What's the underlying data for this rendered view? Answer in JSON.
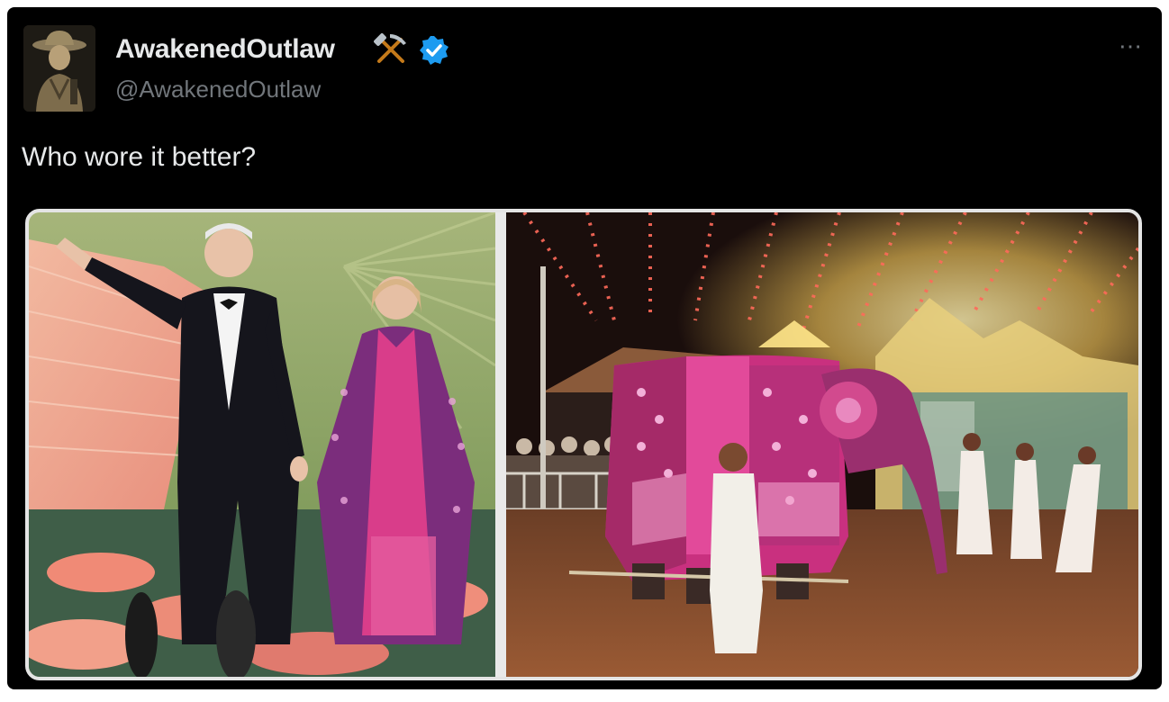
{
  "tweet": {
    "display_name": "AwakenedOutlaw",
    "handle": "@AwakenedOutlaw",
    "text": "Who wore it better?",
    "more_icon": "⋯"
  },
  "icons": {
    "avatar": "avatar-cowboy",
    "badge_emoji": "hammer-and-pick-icon",
    "verified": "verified-badge-icon",
    "more": "more-options-icon"
  },
  "colors": {
    "background": "#000000",
    "text_primary": "#e7e9ea",
    "text_secondary": "#71767b",
    "verified_blue": "#1d9bf0",
    "pick_gold": "#f0a81c"
  }
}
